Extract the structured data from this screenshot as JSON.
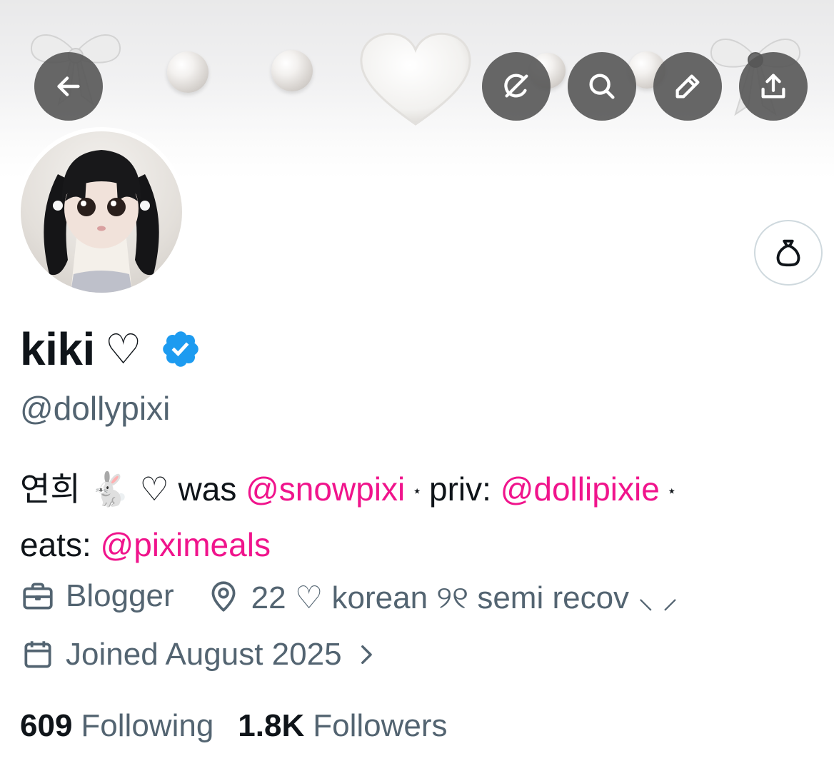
{
  "banner": {
    "decor": [
      "bow-left",
      "pearl",
      "pearl",
      "fluffy-heart",
      "pearl",
      "pearl",
      "bow-right"
    ]
  },
  "toolbar": {
    "back_icon": "arrow-left-icon",
    "grok_icon": "grok-icon",
    "search_icon": "search-icon",
    "edit_icon": "pencil-icon",
    "share_icon": "share-upload-icon"
  },
  "profile": {
    "display_name": "kiki",
    "name_heart": "♡",
    "handle": "@dollypixi",
    "verified": true,
    "tip_icon": "money-bag-icon"
  },
  "bio": {
    "korean": "연희",
    "rabbit": "🐇",
    "heart": "♡",
    "was_label": "was",
    "mention_1": "@snowpixi",
    "star": "⋆",
    "priv_label": "priv:",
    "mention_2": "@dollipixie",
    "eats_label": "eats:",
    "mention_3": "@piximeals"
  },
  "meta": {
    "category": "Blogger",
    "location": "22 ♡ korean ୨୧ semi recov ⸜ ⸝",
    "joined": "Joined August 2025"
  },
  "stats": {
    "following_count": "609",
    "following_label": "Following",
    "followers_count": "1.8K",
    "followers_label": "Followers"
  },
  "colors": {
    "accent": "#f0148c",
    "secondary_text": "#536471",
    "verified": "#1d9bf0"
  }
}
